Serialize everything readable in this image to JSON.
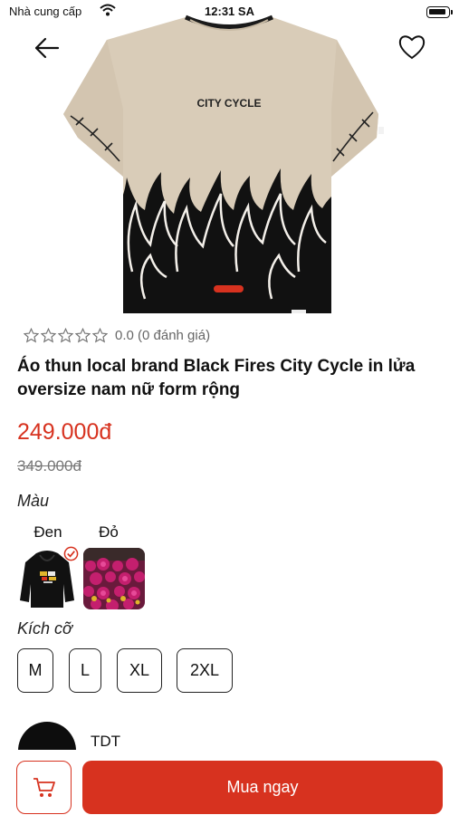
{
  "status_bar": {
    "carrier": "Nhà cung cấp",
    "time": "12:31 SA"
  },
  "product": {
    "print_text": "CITY CYCLE",
    "rating": {
      "stars": 0,
      "text": "0.0 (0 đánh giá)"
    },
    "title": "Áo thun local brand Black Fires City Cycle in lửa oversize nam nữ form rộng",
    "price": "249.000đ",
    "old_price": "349.000đ"
  },
  "colors": {
    "label": "Màu",
    "options": [
      {
        "name": "Đen",
        "selected": true
      },
      {
        "name": "Đỏ",
        "selected": false
      }
    ]
  },
  "sizes": {
    "label": "Kích cỡ",
    "options": [
      "M",
      "L",
      "XL",
      "2XL"
    ]
  },
  "shop": {
    "name": "TDT"
  },
  "actions": {
    "buy_label": "Mua ngay"
  },
  "theme": {
    "accent": "#d7321f",
    "shirt": "#d9ccb8",
    "shirt_dark": "#111111"
  }
}
